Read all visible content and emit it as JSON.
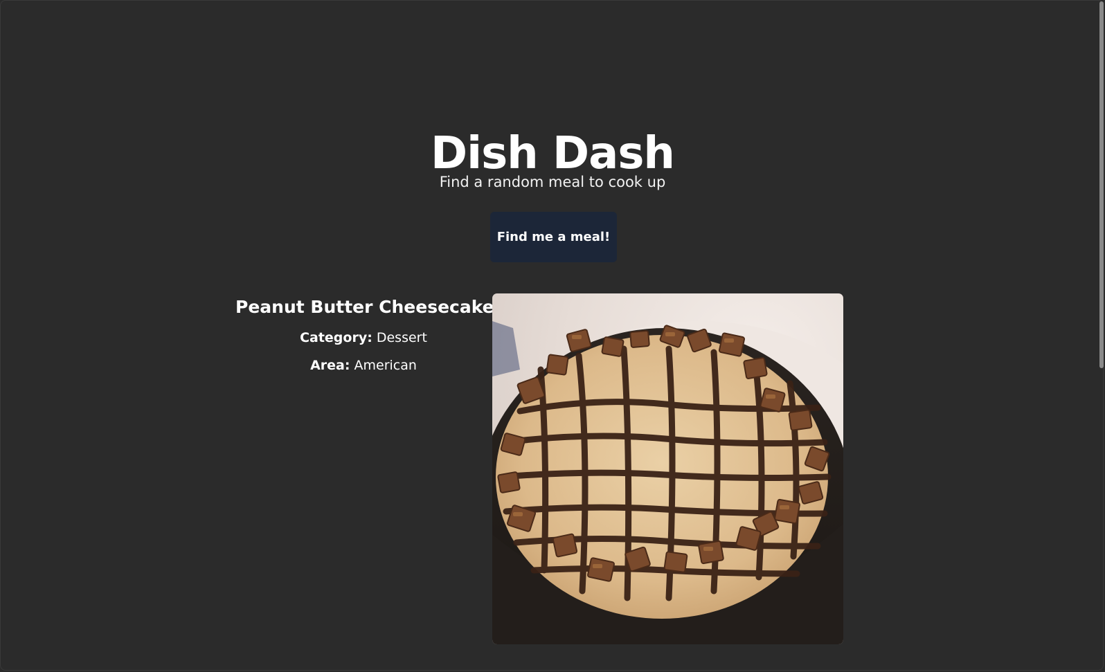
{
  "app": {
    "title": "Dish Dash",
    "subtitle": "Find a random meal to cook up"
  },
  "actions": {
    "find_label": "Find me a meal!"
  },
  "meal": {
    "name": "Peanut Butter Cheesecake",
    "category_label": "Category:",
    "category": "Dessert",
    "area_label": "Area:",
    "area": "American",
    "image_alt": "Peanut Butter Cheesecake"
  },
  "colors": {
    "background": "#2b2b2b",
    "button": "#1c2638",
    "text": "#ffffff"
  }
}
